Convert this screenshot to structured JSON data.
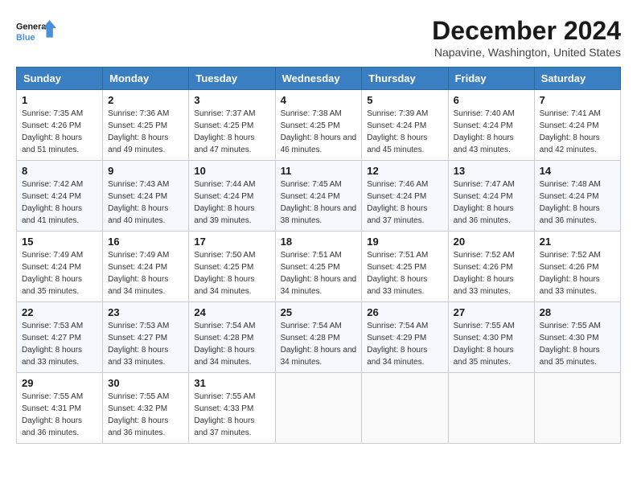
{
  "logo": {
    "line1": "General",
    "line2": "Blue"
  },
  "title": "December 2024",
  "location": "Napavine, Washington, United States",
  "headers": [
    "Sunday",
    "Monday",
    "Tuesday",
    "Wednesday",
    "Thursday",
    "Friday",
    "Saturday"
  ],
  "weeks": [
    [
      {
        "day": "1",
        "sunrise": "7:35 AM",
        "sunset": "4:26 PM",
        "daylight": "8 hours and 51 minutes."
      },
      {
        "day": "2",
        "sunrise": "7:36 AM",
        "sunset": "4:25 PM",
        "daylight": "8 hours and 49 minutes."
      },
      {
        "day": "3",
        "sunrise": "7:37 AM",
        "sunset": "4:25 PM",
        "daylight": "8 hours and 47 minutes."
      },
      {
        "day": "4",
        "sunrise": "7:38 AM",
        "sunset": "4:25 PM",
        "daylight": "8 hours and 46 minutes."
      },
      {
        "day": "5",
        "sunrise": "7:39 AM",
        "sunset": "4:24 PM",
        "daylight": "8 hours and 45 minutes."
      },
      {
        "day": "6",
        "sunrise": "7:40 AM",
        "sunset": "4:24 PM",
        "daylight": "8 hours and 43 minutes."
      },
      {
        "day": "7",
        "sunrise": "7:41 AM",
        "sunset": "4:24 PM",
        "daylight": "8 hours and 42 minutes."
      }
    ],
    [
      {
        "day": "8",
        "sunrise": "7:42 AM",
        "sunset": "4:24 PM",
        "daylight": "8 hours and 41 minutes."
      },
      {
        "day": "9",
        "sunrise": "7:43 AM",
        "sunset": "4:24 PM",
        "daylight": "8 hours and 40 minutes."
      },
      {
        "day": "10",
        "sunrise": "7:44 AM",
        "sunset": "4:24 PM",
        "daylight": "8 hours and 39 minutes."
      },
      {
        "day": "11",
        "sunrise": "7:45 AM",
        "sunset": "4:24 PM",
        "daylight": "8 hours and 38 minutes."
      },
      {
        "day": "12",
        "sunrise": "7:46 AM",
        "sunset": "4:24 PM",
        "daylight": "8 hours and 37 minutes."
      },
      {
        "day": "13",
        "sunrise": "7:47 AM",
        "sunset": "4:24 PM",
        "daylight": "8 hours and 36 minutes."
      },
      {
        "day": "14",
        "sunrise": "7:48 AM",
        "sunset": "4:24 PM",
        "daylight": "8 hours and 36 minutes."
      }
    ],
    [
      {
        "day": "15",
        "sunrise": "7:49 AM",
        "sunset": "4:24 PM",
        "daylight": "8 hours and 35 minutes."
      },
      {
        "day": "16",
        "sunrise": "7:49 AM",
        "sunset": "4:24 PM",
        "daylight": "8 hours and 34 minutes."
      },
      {
        "day": "17",
        "sunrise": "7:50 AM",
        "sunset": "4:25 PM",
        "daylight": "8 hours and 34 minutes."
      },
      {
        "day": "18",
        "sunrise": "7:51 AM",
        "sunset": "4:25 PM",
        "daylight": "8 hours and 34 minutes."
      },
      {
        "day": "19",
        "sunrise": "7:51 AM",
        "sunset": "4:25 PM",
        "daylight": "8 hours and 33 minutes."
      },
      {
        "day": "20",
        "sunrise": "7:52 AM",
        "sunset": "4:26 PM",
        "daylight": "8 hours and 33 minutes."
      },
      {
        "day": "21",
        "sunrise": "7:52 AM",
        "sunset": "4:26 PM",
        "daylight": "8 hours and 33 minutes."
      }
    ],
    [
      {
        "day": "22",
        "sunrise": "7:53 AM",
        "sunset": "4:27 PM",
        "daylight": "8 hours and 33 minutes."
      },
      {
        "day": "23",
        "sunrise": "7:53 AM",
        "sunset": "4:27 PM",
        "daylight": "8 hours and 33 minutes."
      },
      {
        "day": "24",
        "sunrise": "7:54 AM",
        "sunset": "4:28 PM",
        "daylight": "8 hours and 34 minutes."
      },
      {
        "day": "25",
        "sunrise": "7:54 AM",
        "sunset": "4:28 PM",
        "daylight": "8 hours and 34 minutes."
      },
      {
        "day": "26",
        "sunrise": "7:54 AM",
        "sunset": "4:29 PM",
        "daylight": "8 hours and 34 minutes."
      },
      {
        "day": "27",
        "sunrise": "7:55 AM",
        "sunset": "4:30 PM",
        "daylight": "8 hours and 35 minutes."
      },
      {
        "day": "28",
        "sunrise": "7:55 AM",
        "sunset": "4:30 PM",
        "daylight": "8 hours and 35 minutes."
      }
    ],
    [
      {
        "day": "29",
        "sunrise": "7:55 AM",
        "sunset": "4:31 PM",
        "daylight": "8 hours and 36 minutes."
      },
      {
        "day": "30",
        "sunrise": "7:55 AM",
        "sunset": "4:32 PM",
        "daylight": "8 hours and 36 minutes."
      },
      {
        "day": "31",
        "sunrise": "7:55 AM",
        "sunset": "4:33 PM",
        "daylight": "8 hours and 37 minutes."
      },
      null,
      null,
      null,
      null
    ]
  ],
  "labels": {
    "sunrise": "Sunrise:",
    "sunset": "Sunset:",
    "daylight": "Daylight:"
  }
}
